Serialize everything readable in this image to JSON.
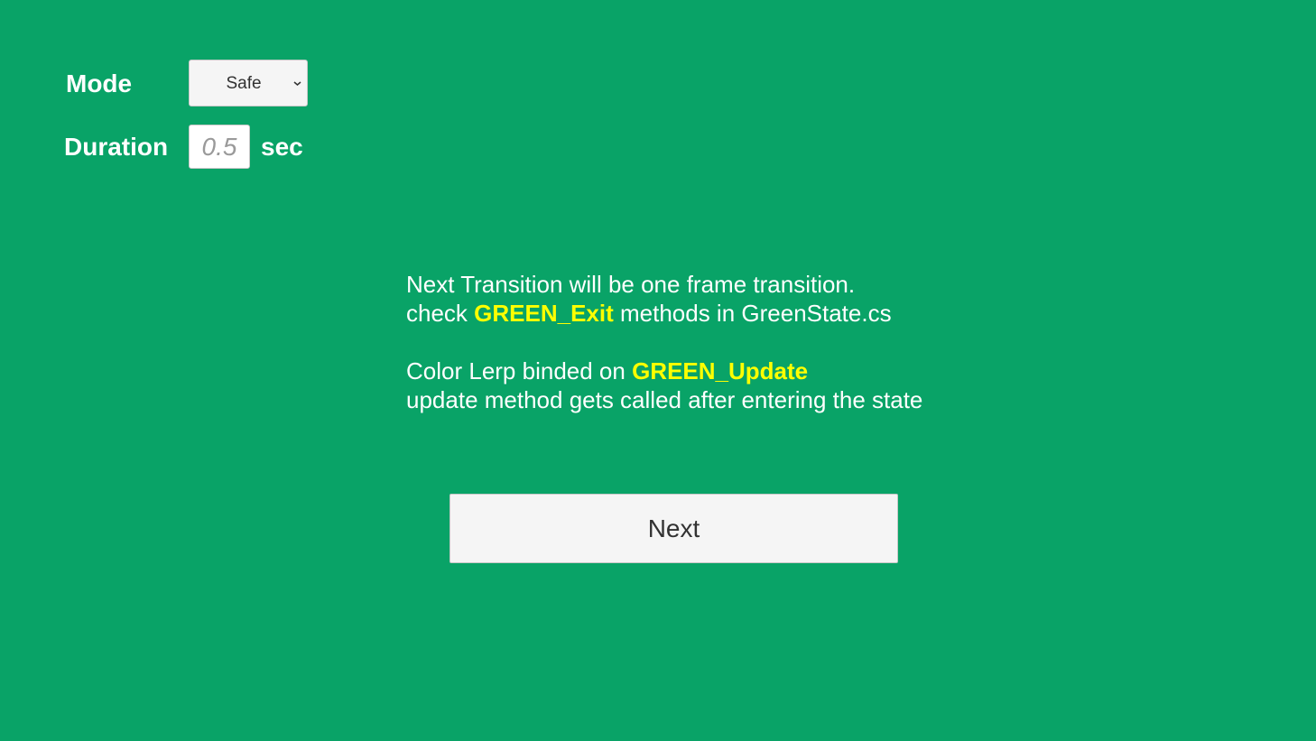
{
  "settings": {
    "mode_label": "Mode",
    "mode_value": "Safe",
    "duration_label": "Duration",
    "duration_placeholder": "0.5",
    "duration_unit": "sec"
  },
  "info": {
    "line1": "Next Transition will be one frame transition.",
    "line2_prefix": "check ",
    "line2_highlight": "GREEN_Exit",
    "line2_suffix": " methods in GreenState.cs",
    "line3_prefix": "Color Lerp binded on ",
    "line3_highlight": "GREEN_Update",
    "line4": "update method gets called after entering the state"
  },
  "actions": {
    "next_label": "Next"
  },
  "colors": {
    "background": "#09a367",
    "highlight": "#ffff00",
    "text": "#ffffff"
  }
}
